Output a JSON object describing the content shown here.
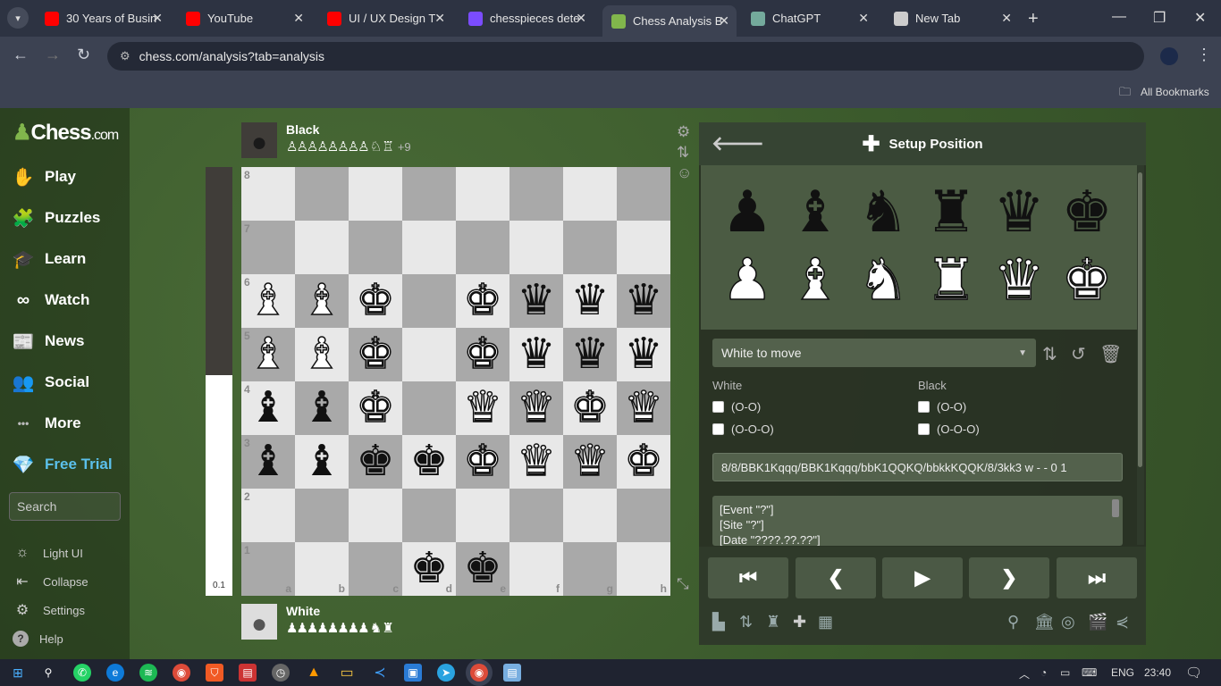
{
  "browser": {
    "tabs": [
      {
        "title": "30 Years of Busin",
        "icon": "youtube-icon",
        "color": "#ff0000"
      },
      {
        "title": "YouTube",
        "icon": "youtube-icon",
        "color": "#ff0000"
      },
      {
        "title": "UI / UX Design T",
        "icon": "youtube-icon",
        "color": "#ff0000"
      },
      {
        "title": "chesspieces dete",
        "icon": "perplexity-icon",
        "color": "#7b4cff"
      },
      {
        "title": "Chess Analysis B",
        "icon": "chess-pawn-icon",
        "color": "#81b64c"
      },
      {
        "title": "ChatGPT",
        "icon": "chatgpt-icon",
        "color": "#74aa9c"
      },
      {
        "title": "New Tab",
        "icon": "chrome-icon",
        "color": "#cccccc"
      }
    ],
    "active_tab": 4,
    "url": "chess.com/analysis?tab=analysis",
    "bookmarks_label": "All Bookmarks"
  },
  "sidebar": {
    "logo": {
      "main": "Chess",
      "suffix": ".com"
    },
    "items": [
      {
        "label": "Play",
        "icon": "play-hand-icon"
      },
      {
        "label": "Puzzles",
        "icon": "puzzle-icon"
      },
      {
        "label": "Learn",
        "icon": "learn-cap-icon"
      },
      {
        "label": "Watch",
        "icon": "binoculars-icon"
      },
      {
        "label": "News",
        "icon": "newspaper-icon"
      },
      {
        "label": "Social",
        "icon": "social-people-icon"
      },
      {
        "label": "More",
        "icon": "ellipsis-icon"
      },
      {
        "label": "Free Trial",
        "icon": "diamond-icon"
      }
    ],
    "search_placeholder": "Search",
    "footer": [
      {
        "label": "Light UI",
        "icon": "sun-icon"
      },
      {
        "label": "Collapse",
        "icon": "collapse-icon"
      },
      {
        "label": "Settings",
        "icon": "gear-icon"
      },
      {
        "label": "Help",
        "icon": "help-icon"
      }
    ]
  },
  "board": {
    "eval": "0.1",
    "eval_black_fraction": 0.485,
    "top_player": {
      "name": "Black",
      "captured": "♙♙♙♙♙♙♙♙ ♘ ♖",
      "advantage": "+9"
    },
    "bottom_player": {
      "name": "White",
      "captured": "♟♟♟♟♟♟♟♟ ♞ ♜"
    },
    "files": [
      "a",
      "b",
      "c",
      "d",
      "e",
      "f",
      "g",
      "h"
    ],
    "ranks": [
      "8",
      "7",
      "6",
      "5",
      "4",
      "3",
      "2",
      "1"
    ],
    "position": [
      [
        "",
        "",
        "",
        "",
        "",
        "",
        "",
        ""
      ],
      [
        "",
        "",
        "",
        "",
        "",
        "",
        "",
        ""
      ],
      [
        "B",
        "B",
        "K",
        "",
        "K",
        "q",
        "q",
        "q"
      ],
      [
        "B",
        "B",
        "K",
        "",
        "K",
        "q",
        "q",
        "q"
      ],
      [
        "b",
        "b",
        "K",
        "",
        "Q",
        "Q",
        "K",
        "Q"
      ],
      [
        "b",
        "b",
        "k",
        "k",
        "K",
        "Q",
        "Q",
        "K"
      ],
      [
        "",
        "",
        "",
        "",
        "",
        "",
        "",
        ""
      ],
      [
        "",
        "",
        "",
        "k",
        "k",
        "",
        "",
        ""
      ]
    ]
  },
  "setup": {
    "title": "Setup Position",
    "tray_black": [
      "♟",
      "♝",
      "♞",
      "♜",
      "♛",
      "♚"
    ],
    "tray_white": [
      "♟",
      "♝",
      "♞",
      "♜",
      "♛",
      "♚"
    ],
    "side_to_move": "White to move",
    "white_label": "White",
    "black_label": "Black",
    "castle_short": "(O-O)",
    "castle_long": "(O-O-O)",
    "fen": "8/8/BBK1Kqqq/BBK1Kqqq/bbK1QQKQ/bbkkKQQK/8/3kk3 w - - 0 1",
    "pgn": [
      "[Event \"?\"]",
      "[Site \"?\"]",
      "[Date \"????.??.??\"]"
    ]
  },
  "system": {
    "lang": "ENG",
    "time": "23:40"
  }
}
